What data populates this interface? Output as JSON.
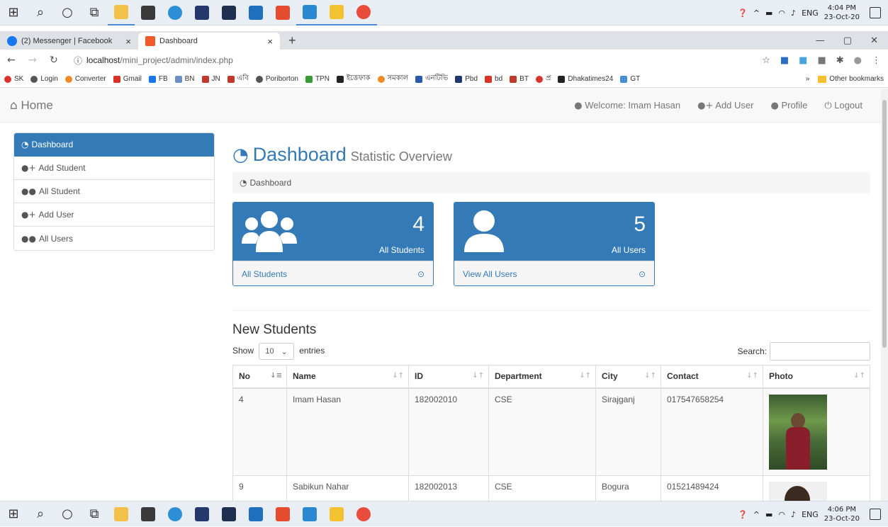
{
  "taskbar": {
    "tray": {
      "lang": "ENG",
      "time_top": "4:04 PM",
      "date_top": "23-Oct-20",
      "time_bottom": "4:06 PM",
      "date_bottom": "23-Oct-20"
    }
  },
  "browser": {
    "tabs": [
      {
        "label": "(2) Messenger | Facebook",
        "close": "×"
      },
      {
        "label": "Dashboard",
        "close": "×"
      }
    ],
    "new_tab": "+",
    "url_host": "localhost",
    "url_path": "/mini_project/admin/index.php",
    "bookmarks": [
      "SK",
      "Login",
      "Converter",
      "Gmail",
      "FB",
      "BN",
      "JN",
      "এবি",
      "Poriborton",
      "TPN",
      "ইত্তেফাক",
      "সমকাল",
      "এনটিভি",
      "Pbd",
      "bd",
      "BT",
      "প্র",
      "Dhakatimes24",
      "GT"
    ],
    "more_bookmarks": "»",
    "other_bookmarks": "Other bookmarks"
  },
  "navbar": {
    "brand": "Home",
    "welcome": "Welcome: Imam Hasan",
    "add_user": "Add User",
    "profile": "Profile",
    "logout": "Logout"
  },
  "sidebar": {
    "items": [
      {
        "label": "Dashboard"
      },
      {
        "label": "Add Student"
      },
      {
        "label": "All Student"
      },
      {
        "label": "Add User"
      },
      {
        "label": "All Users"
      }
    ]
  },
  "main": {
    "title": "Dashboard",
    "subtitle": "Statistic Overview",
    "breadcrumb": "Dashboard",
    "cards": [
      {
        "count": "4",
        "label": "All Students",
        "link": "All Students"
      },
      {
        "count": "5",
        "label": "All Users",
        "link": "View All Users"
      }
    ],
    "section_title": "New Students",
    "show_label": "Show",
    "entries_value": "10",
    "entries_label": "entries",
    "search_label": "Search:",
    "table": {
      "headers": [
        "No",
        "Name",
        "ID",
        "Department",
        "City",
        "Contact",
        "Photo"
      ],
      "rows": [
        {
          "no": "4",
          "name": "Imam Hasan",
          "id": "182002010",
          "department": "CSE",
          "city": "Sirajganj",
          "contact": "017547658254"
        },
        {
          "no": "9",
          "name": "Sabikun Nahar",
          "id": "182002013",
          "department": "CSE",
          "city": "Bogura",
          "contact": "01521489424"
        }
      ]
    }
  },
  "colors": {
    "primary": "#337ab7",
    "panel_bg": "#f5f5f5",
    "navbar_bg": "#f8f8f8"
  }
}
